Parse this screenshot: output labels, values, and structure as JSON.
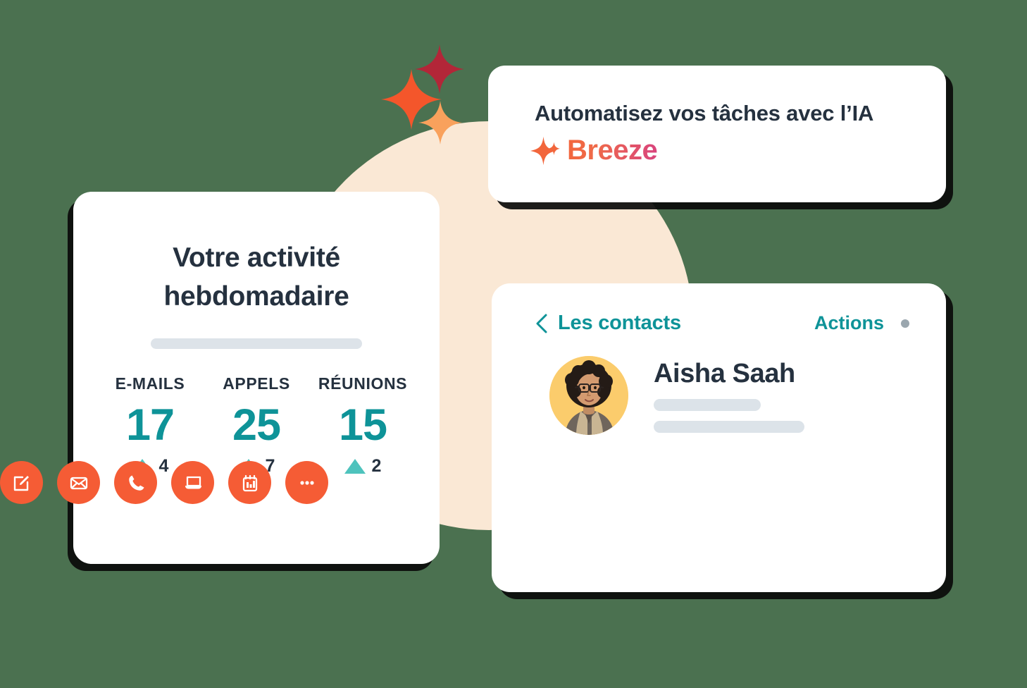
{
  "theme": {
    "background": "#4B7150",
    "circle": "#FAE8D5",
    "card_bg": "#FFFFFF",
    "teal": "#0E9398",
    "teal_light": "#4EC3BD",
    "navy": "#25313F",
    "orange": "#F55C35",
    "avatar_yellow": "#FBCC6C",
    "placeholder_gray": "#DCE3E9",
    "sparkle_red": "#B32638",
    "sparkle_orange": "#F4562B",
    "sparkle_light_orange": "#F9A15C",
    "breeze_gradient_start": "#F2663C",
    "breeze_gradient_end": "#D8437E"
  },
  "activity_card": {
    "title_line1": "Votre activité",
    "title_line2": "hebdomadaire",
    "stats": [
      {
        "label": "E-MAILS",
        "value": "17",
        "delta": "4",
        "trend": "up"
      },
      {
        "label": "APPELS",
        "value": "25",
        "delta": "7",
        "trend": "up"
      },
      {
        "label": "RÉUNIONS",
        "value": "15",
        "delta": "2",
        "trend": "up"
      }
    ]
  },
  "breeze_card": {
    "headline": "Automatisez vos tâches avec l’IA",
    "logo_text": "Breeze",
    "logo_icon": "sparkle-icon"
  },
  "contacts_card": {
    "back_label": "Les contacts",
    "back_icon": "chevron-left-icon",
    "actions_label": "Actions",
    "actions_dot_icon": "dot-icon",
    "contact": {
      "name": "Aisha Saah",
      "avatar_alt": "portrait-photo"
    },
    "action_buttons": [
      {
        "icon": "note-edit-icon",
        "name": "create-note-button"
      },
      {
        "icon": "envelope-icon",
        "name": "send-email-button"
      },
      {
        "icon": "phone-icon",
        "name": "call-button"
      },
      {
        "icon": "laptop-icon",
        "name": "schedule-meeting-button"
      },
      {
        "icon": "calendar-task-icon",
        "name": "create-task-button"
      },
      {
        "icon": "ellipsis-icon",
        "name": "more-actions-button"
      }
    ]
  },
  "decorations": {
    "sparkles": [
      {
        "name": "sparkle-red",
        "color": "#B32638"
      },
      {
        "name": "sparkle-orange",
        "color": "#F4562B"
      },
      {
        "name": "sparkle-light-orange",
        "color": "#F9A15C"
      }
    ]
  }
}
